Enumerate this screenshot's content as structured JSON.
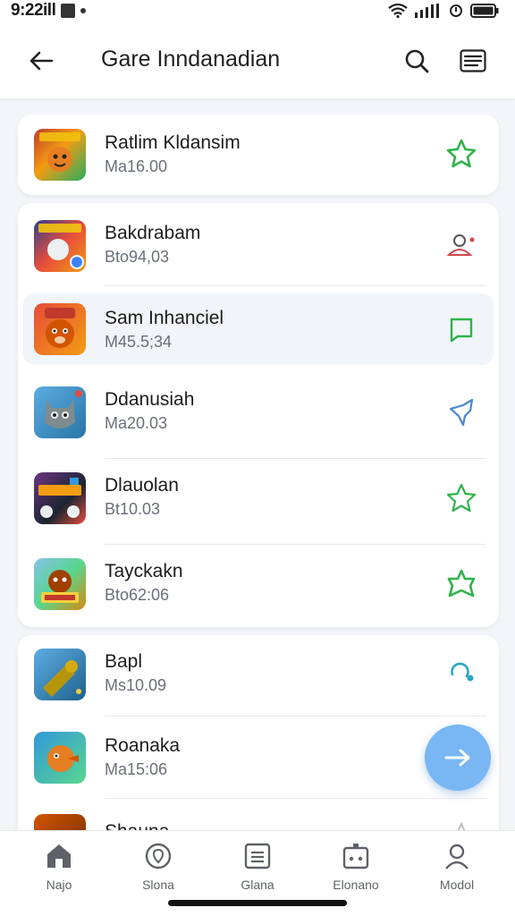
{
  "status_bar": {
    "time": "9:22ill"
  },
  "app_bar": {
    "title": "Gare Inndanadian"
  },
  "colors": {
    "accent_green": "#2fb34a",
    "accent_blue": "#4a86d8",
    "fab": "#78b6f4"
  },
  "items": [
    {
      "title": "Ratlim Kldansim",
      "subtitle": "Ma16.00",
      "icon": "star-outline-icon",
      "action_color": "#2fb34a"
    },
    {
      "title": "Bakdrabam",
      "subtitle": "Bto94,03",
      "icon": "person-remove-icon",
      "action_color": "#d0464a"
    },
    {
      "title": "Sam Inhanciel",
      "subtitle": "M45.5;34",
      "icon": "comment-icon",
      "action_color": "#2fb34a"
    },
    {
      "title": "Ddanusiah",
      "subtitle": "Ma20.03",
      "icon": "pin-icon",
      "action_color": "#4a86d8"
    },
    {
      "title": "Dlauolan",
      "subtitle": "Bt10.03",
      "icon": "star-outline-icon",
      "action_color": "#2fb34a"
    },
    {
      "title": "Tayckakn",
      "subtitle": "Bto62:06",
      "icon": "star-badge-icon",
      "action_color": "#2fb34a"
    },
    {
      "title": "Bapl",
      "subtitle": "Ms10.09",
      "icon": "refresh-icon",
      "action_color": "#2aa5c8"
    },
    {
      "title": "Roanaka",
      "subtitle": "Ma15:06",
      "icon": "",
      "action_color": ""
    },
    {
      "title": "Shauna",
      "subtitle": "",
      "icon": "star-outline-icon",
      "action_color": "#bbbbbb"
    }
  ],
  "bottom_nav": [
    {
      "label": "Najo",
      "icon": "home-icon"
    },
    {
      "label": "Slona",
      "icon": "location-icon"
    },
    {
      "label": "Glana",
      "icon": "list-icon"
    },
    {
      "label": "Elonano",
      "icon": "games-icon"
    },
    {
      "label": "Modol",
      "icon": "profile-icon"
    }
  ]
}
